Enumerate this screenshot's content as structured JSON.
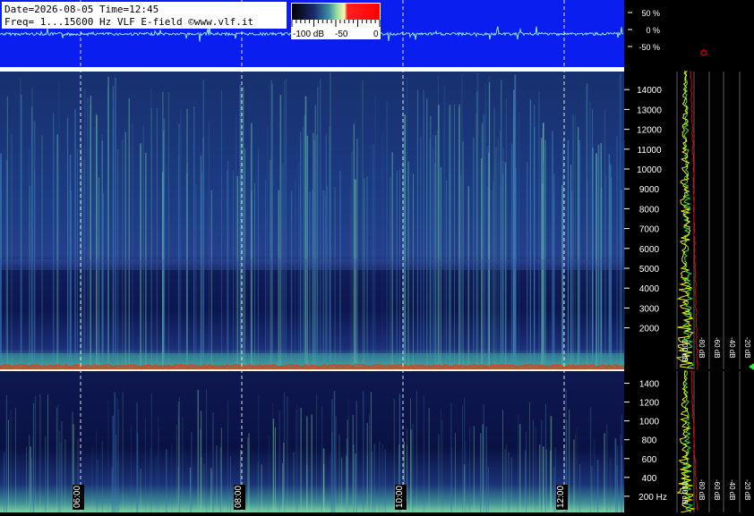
{
  "header": {
    "date_line": "Date=2026-08-05 Time=12:45",
    "freq_line": "Freq= 1...15000 Hz   VLF E-field ©www.vlf.it"
  },
  "colorbar": {
    "labels": [
      "-100 dB",
      "-50",
      "0"
    ],
    "colors": [
      "#000000",
      "#1a2a6c",
      "#3c8ea0",
      "#9fe0a0",
      "#fff6b0",
      "#ff2020",
      "#ff0000"
    ]
  },
  "waveform": {
    "percent_labels": [
      "50 %",
      "0 %",
      "-50 %"
    ],
    "background": "#0a1ef0",
    "trace_color": "#8fe8ff"
  },
  "colors": {
    "background": "#000000",
    "spectrogram_dark": "#0a1240",
    "spectrogram_mid": "#1f3a8a",
    "spectrogram_green": "#4fb08a",
    "profile_green": "#39e83a",
    "profile_yellow": "#f3f000",
    "profile_red": "#e00000"
  },
  "chart_data": [
    {
      "type": "heatmap",
      "title": "",
      "xlabel": "",
      "ylabel": "",
      "ylim": [
        0,
        15000
      ],
      "y_ticks": [
        2000,
        3000,
        4000,
        5000,
        6000,
        7000,
        8000,
        9000,
        10000,
        11000,
        12000,
        13000,
        14000
      ],
      "y_tick_labels": [
        "2000",
        "3000",
        "4000",
        "5000",
        "6000",
        "7000",
        "8000",
        "9000",
        "10000",
        "11000",
        "12000",
        "13000",
        "14000"
      ],
      "time_ticks": [
        "06:00",
        "08:00",
        "10:00",
        "12:00"
      ],
      "features": {
        "enhanced_band_hz": [
          3000,
          5000
        ],
        "lower_band_hz": [
          1000,
          2000
        ],
        "baseline_hz": [
          0,
          150
        ]
      }
    },
    {
      "type": "heatmap",
      "title": "",
      "ylim": [
        0,
        1500
      ],
      "y_ticks": [
        200,
        400,
        600,
        800,
        1000,
        1200,
        1400
      ],
      "y_tick_labels": [
        "200 Hz",
        "400",
        "600",
        "800",
        "1000",
        "1200",
        "1400"
      ],
      "time_ticks": [
        "06:00",
        "08:00",
        "10:00",
        "12:00"
      ]
    },
    {
      "type": "line",
      "title": "",
      "x_ticks": [
        -100,
        -80,
        -60,
        -40,
        -20
      ],
      "x_tick_labels": [
        "-100 dB",
        "-80 dB",
        "-60 dB",
        "-40 dB",
        "-20 dB"
      ],
      "series": [
        {
          "color": "#39e83a"
        },
        {
          "color": "#f3f000"
        },
        {
          "color": "#e00000"
        }
      ]
    }
  ]
}
